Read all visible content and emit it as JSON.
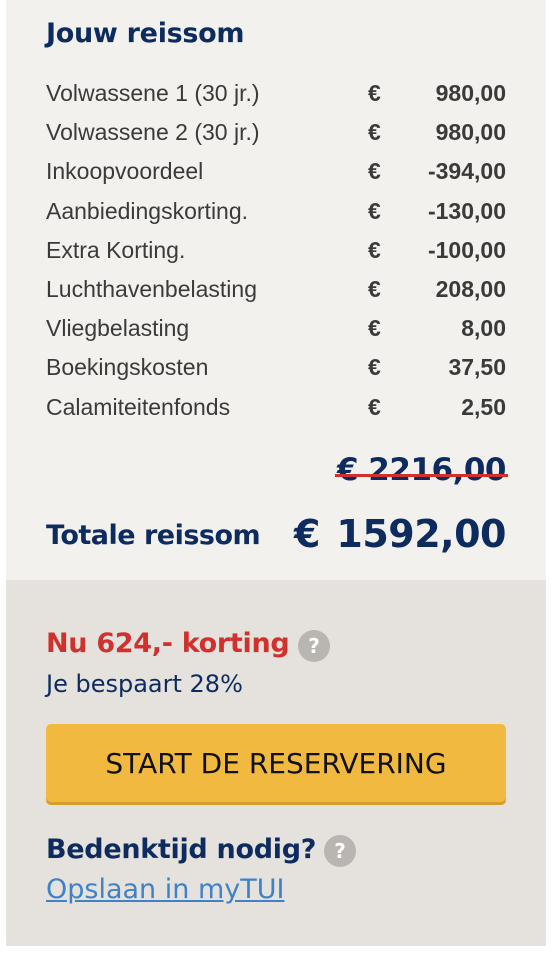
{
  "summary": {
    "title": "Jouw reissom",
    "rows": [
      {
        "label": "Volwassene 1 (30 jr.)",
        "currency": "€",
        "amount": "980,00"
      },
      {
        "label": "Volwassene 2 (30 jr.)",
        "currency": "€",
        "amount": "980,00"
      },
      {
        "label": "Inkoopvoordeel",
        "currency": "€",
        "amount": "-394,00"
      },
      {
        "label": "Aanbiedingskorting.",
        "currency": "€",
        "amount": "-130,00"
      },
      {
        "label": "Extra Korting.",
        "currency": "€",
        "amount": "-100,00"
      },
      {
        "label": "Luchthavenbelasting",
        "currency": "€",
        "amount": "208,00"
      },
      {
        "label": "Vliegbelasting",
        "currency": "€",
        "amount": "8,00"
      },
      {
        "label": "Boekingskosten",
        "currency": "€",
        "amount": "37,50"
      },
      {
        "label": "Calamiteitenfonds",
        "currency": "€",
        "amount": "2,50"
      }
    ],
    "old_price": "€ 2216,00",
    "total_label": "Totale reissom",
    "total_currency": "€",
    "total_amount": "1592,00"
  },
  "offer": {
    "discount_text": "Nu 624,- korting",
    "help_icon": "question-mark-icon",
    "savings_text": "Je bespaart 28%",
    "cta_label": "START DE RESERVERING",
    "think_label": "Bedenktijd nodig?",
    "save_link": "Opslaan in myTUI"
  },
  "colors": {
    "navy": "#0d2b5e",
    "red": "#d0312d",
    "cta": "#f2b940",
    "link": "#3f82c7",
    "summary_bg": "#f2f1ee",
    "lower_bg": "#e5e1dc"
  }
}
